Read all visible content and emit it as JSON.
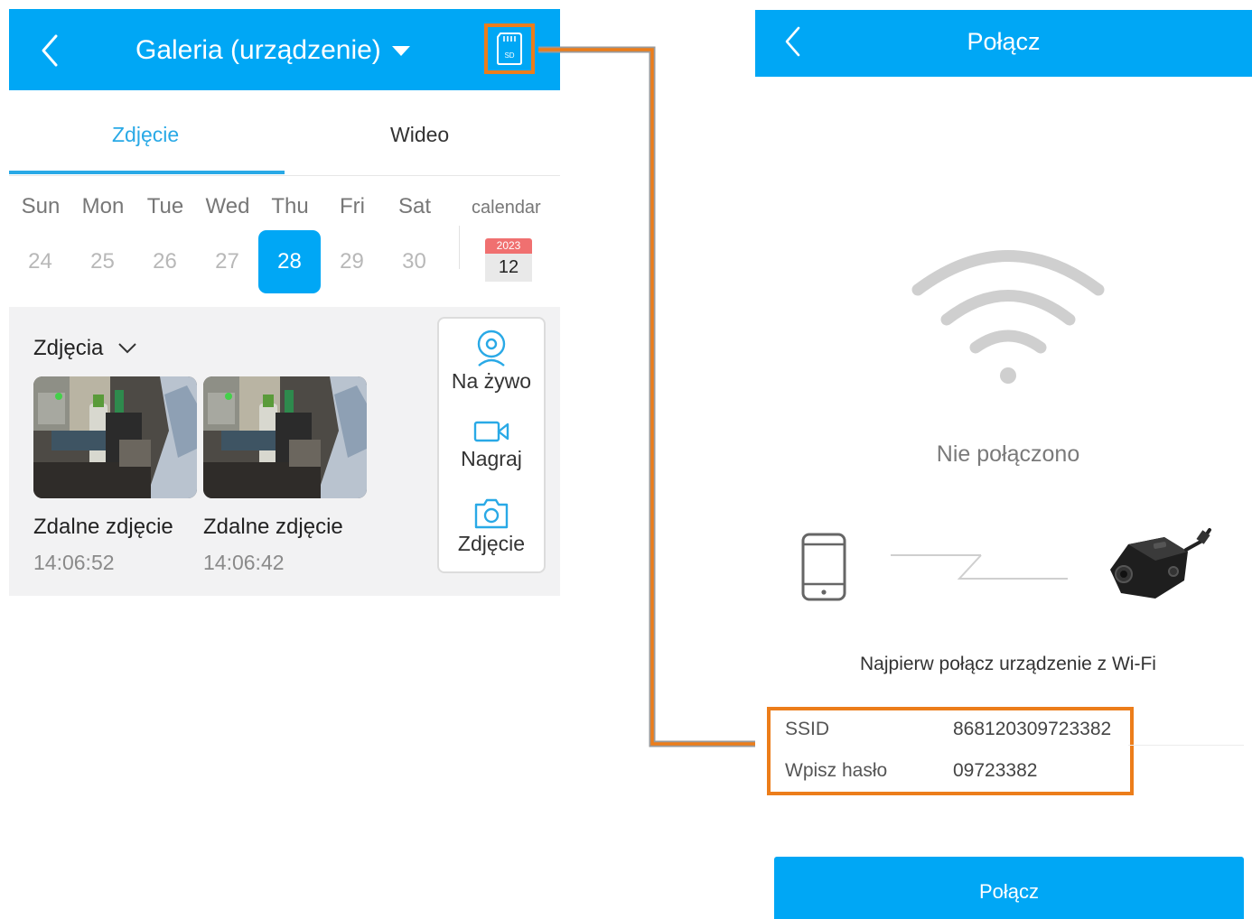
{
  "gallery_screen": {
    "title": "Galeria (urządzenie)",
    "icons": {
      "back": "chevron-left-icon",
      "dropdown": "caret-down-icon",
      "sd_card": "sd-card-icon"
    },
    "sd_label": "SD",
    "tabs": [
      {
        "label": "Zdjęcie",
        "active": true
      },
      {
        "label": "Wideo",
        "active": false
      }
    ],
    "weekdays": [
      "Sun",
      "Mon",
      "Tue",
      "Wed",
      "Thu",
      "Fri",
      "Sat"
    ],
    "days": [
      "24",
      "25",
      "26",
      "27",
      "28",
      "29",
      "30"
    ],
    "selected_day": "28",
    "calendar": {
      "label": "calendar",
      "year": "2023",
      "month": "12"
    },
    "section": {
      "title": "Zdjęcia"
    },
    "photos": [
      {
        "title": "Zdalne zdjęcie",
        "time": "14:06:52"
      },
      {
        "title": "Zdalne zdjęcie",
        "time": "14:06:42"
      }
    ],
    "actions": [
      {
        "label": "Na żywo",
        "icon": "webcam-icon"
      },
      {
        "label": "Nagraj",
        "icon": "video-camera-icon"
      },
      {
        "label": "Zdjęcie",
        "icon": "photo-camera-icon"
      }
    ]
  },
  "connect_screen": {
    "title": "Połącz",
    "status": "Nie połączono",
    "hint": "Najpierw połącz urządzenie z Wi-Fi",
    "credentials": [
      {
        "key": "SSID",
        "value": "868120309723382"
      },
      {
        "key": "Wpisz hasło",
        "value": "09723382"
      }
    ],
    "button": "Połącz"
  },
  "colors": {
    "primary": "#00a7f5",
    "tab_active": "#29a9e6",
    "highlight": "#ec7d1a",
    "panel_bg": "#f2f2f3"
  }
}
